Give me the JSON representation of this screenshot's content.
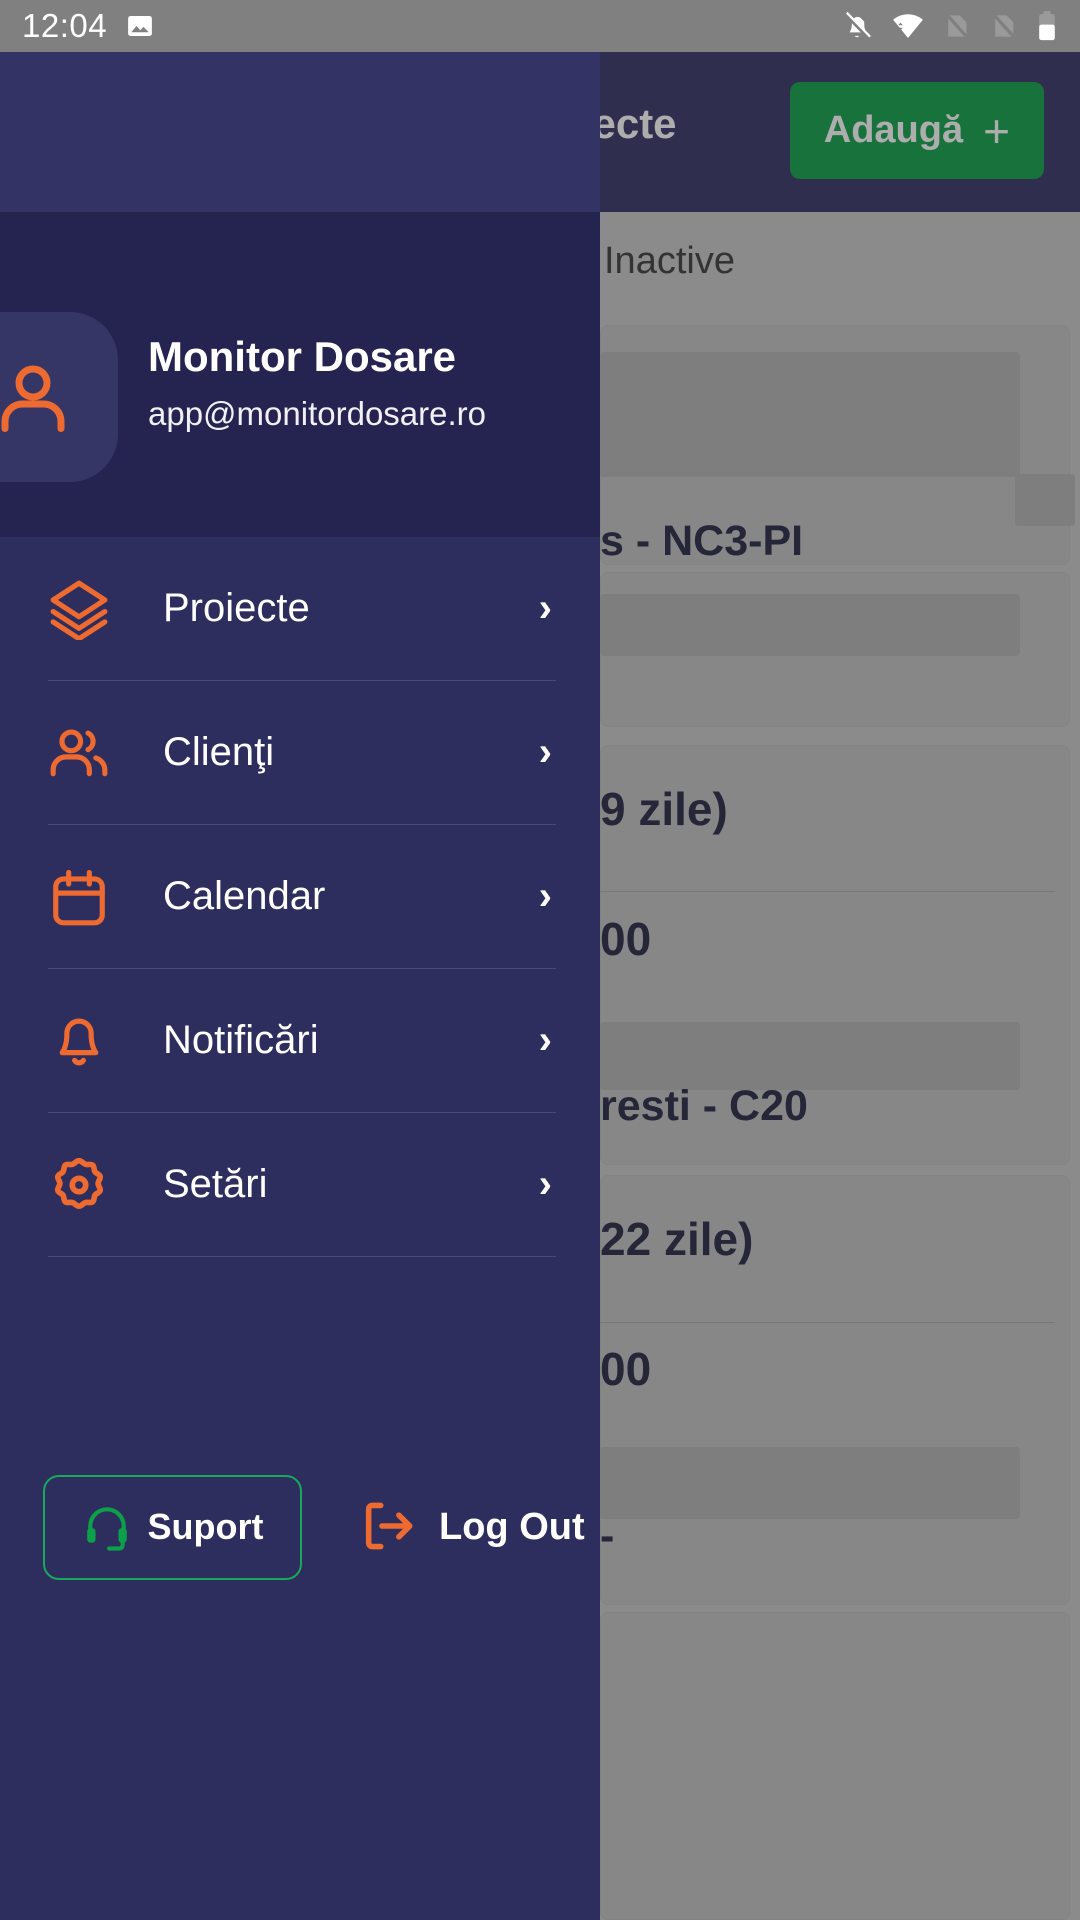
{
  "status_bar": {
    "time": "12:04",
    "icons": [
      "screenshot-icon",
      "notifications-off-icon",
      "wifi-icon",
      "no-sim-1-icon",
      "no-sim-2-icon",
      "battery-icon"
    ]
  },
  "app_bar": {
    "menu_icon": "hamburger-icon",
    "title": "Listă proiecte",
    "add_label": "Adaugă",
    "add_plus": "+"
  },
  "drawer": {
    "account": {
      "avatar_icon": "user-icon",
      "name": "Monitor Dosare",
      "email": "app@monitordosare.ro"
    },
    "items": [
      {
        "label": "Proiecte",
        "icon": "layers-icon",
        "chevron": "›"
      },
      {
        "label": "Clienţi",
        "icon": "users-icon",
        "chevron": "›"
      },
      {
        "label": "Calendar",
        "icon": "calendar-icon",
        "chevron": "›"
      },
      {
        "label": "Notificări",
        "icon": "bell-icon",
        "chevron": "›"
      },
      {
        "label": "Setări",
        "icon": "gear-icon",
        "chevron": "›"
      }
    ],
    "footer": {
      "support_label": "Suport",
      "support_icon": "headset-icon",
      "logout_label": "Log Out",
      "logout_icon": "logout-icon"
    }
  },
  "background": {
    "tab_inactive": "Inactive",
    "fragments": [
      "s - NC3-PI",
      "9 zile)",
      "00",
      "resti - C20",
      "22 zile)",
      "00",
      "-"
    ]
  },
  "colors": {
    "app_bar": "#343366",
    "drawer": "#2d2d5e",
    "drawer_header": "#252350",
    "accent_orange": "#ED6A30",
    "accent_green": "#0da04a",
    "support_border": "#17a95b",
    "status_bar": "#808080"
  }
}
